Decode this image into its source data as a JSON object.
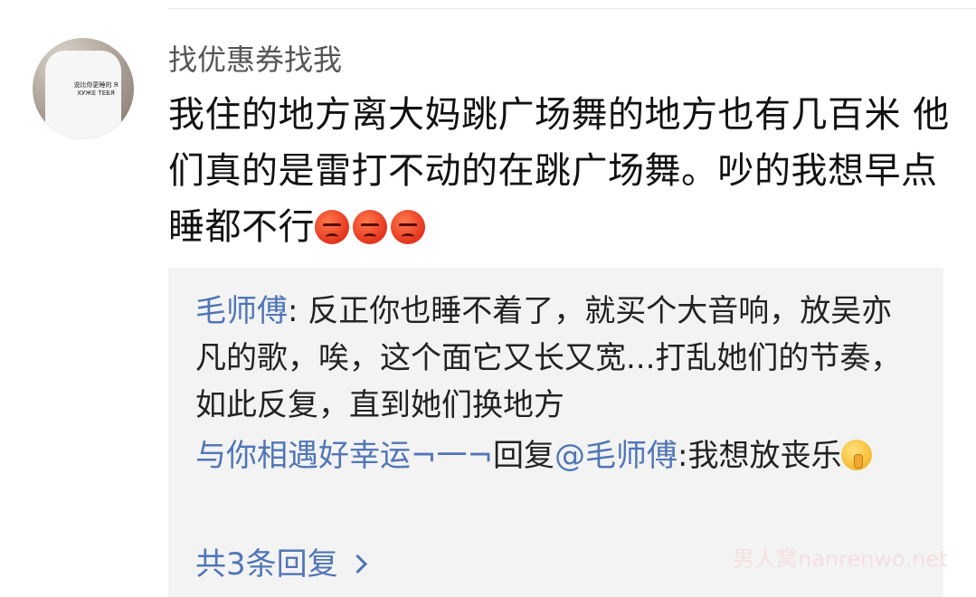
{
  "comment": {
    "username": "找优惠券找我",
    "avatar_text": "说比你更睡的 Я ХУЖЕ ТЕБЯ",
    "body": "我住的地方离大妈跳广场舞的地方也有几百米  他们真的是雷打不动的在跳广场舞。吵的我想早点睡都不行",
    "emojis": [
      "angry-face-icon",
      "angry-face-icon",
      "angry-face-icon"
    ]
  },
  "replies": [
    {
      "author": "毛师傅",
      "separator": ": ",
      "text": "反正你也睡不着了，就买个大音响，放吴亦凡的歌，唉，这个面它又长又宽...打乱她们的节奏，如此反复，直到她们换地方"
    },
    {
      "author": "与你相遇好幸运¬一¬",
      "reply_word": "回复",
      "mention": "@毛师傅",
      "separator": ":",
      "text": "我想放丧乐",
      "emoji": "shush-face-icon"
    }
  ],
  "more_replies_label": "共3条回复",
  "watermark": "男人窝nanrenwo.net",
  "colors": {
    "link_blue": "#5076b6",
    "reply_bg": "#f3f3f3",
    "username_gray": "#555555"
  }
}
